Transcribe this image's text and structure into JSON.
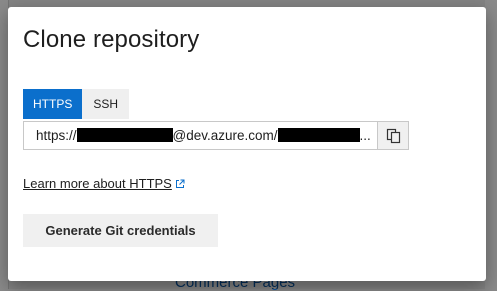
{
  "dialog": {
    "title": "Clone repository",
    "tabs": [
      {
        "label": "HTTPS",
        "active": true
      },
      {
        "label": "SSH",
        "active": false
      }
    ],
    "url": {
      "prefix": "https://",
      "middle": "@dev.azure.com/",
      "suffix": "..."
    },
    "learn_link": "Learn more about HTTPS",
    "generate_button": "Generate Git credentials"
  },
  "background": {
    "link_text": "Commerce Pages"
  },
  "colors": {
    "accent": "#0b6fcc",
    "scrim": "rgba(0,0,0,0.46)"
  }
}
